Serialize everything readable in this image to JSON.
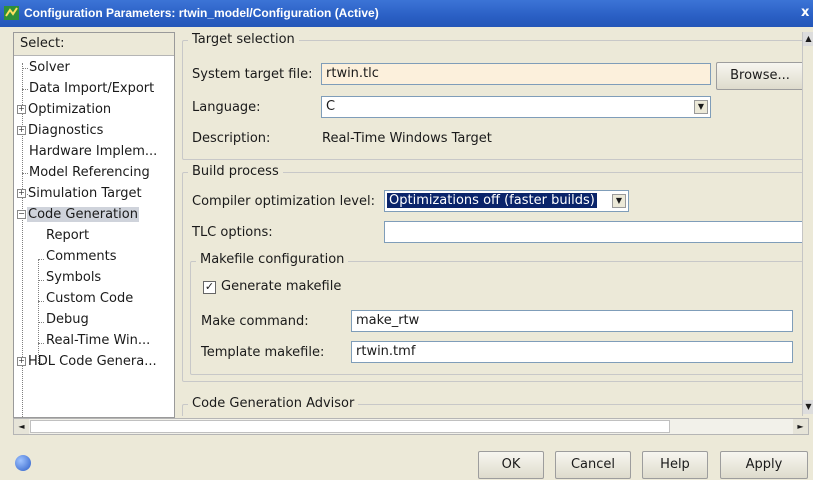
{
  "window": {
    "title": "Configuration Parameters: rtwin_model/Configuration (Active)",
    "close_glyph": "x"
  },
  "tree": {
    "header": "Select:",
    "items": [
      {
        "label": "Solver"
      },
      {
        "label": "Data Import/Export"
      },
      {
        "label": "Optimization",
        "expandable": true
      },
      {
        "label": "Diagnostics",
        "expandable": true
      },
      {
        "label": "Hardware Implem..."
      },
      {
        "label": "Model Referencing"
      },
      {
        "label": "Simulation Target",
        "expandable": true
      },
      {
        "label": "Code Generation",
        "expanded": true,
        "selected": true
      },
      {
        "label": "Report"
      },
      {
        "label": "Comments"
      },
      {
        "label": "Symbols"
      },
      {
        "label": "Custom Code"
      },
      {
        "label": "Debug"
      },
      {
        "label": "Real-Time Win..."
      },
      {
        "label": "HDL Code Genera...",
        "expandable": true
      }
    ]
  },
  "target_selection": {
    "title": "Target selection",
    "system_target_file_label": "System target file:",
    "system_target_file_value": "rtwin.tlc",
    "browse_label": "Browse...",
    "language_label": "Language:",
    "language_value": "C",
    "description_label": "Description:",
    "description_value": "Real-Time Windows Target"
  },
  "build_process": {
    "title": "Build process",
    "compiler_opt_label": "Compiler optimization level:",
    "compiler_opt_value": "Optimizations off (faster builds)",
    "tlc_options_label": "TLC options:",
    "tlc_options_value": "",
    "makefile": {
      "title": "Makefile configuration",
      "generate_label": "Generate makefile",
      "generate_checked": true,
      "make_command_label": "Make command:",
      "make_command_value": "make_rtw",
      "template_label": "Template makefile:",
      "template_value": "rtwin.tmf"
    }
  },
  "advisor": {
    "title": "Code Generation Advisor"
  },
  "buttons": {
    "ok": "OK",
    "cancel": "Cancel",
    "help": "Help",
    "apply": "Apply"
  },
  "glyphs": {
    "check": "✓",
    "dropdown": "▼",
    "up": "▲",
    "down": "▼",
    "left": "◄",
    "right": "►",
    "plus": "+",
    "minus": "−"
  },
  "colors": {
    "title_bar": "#2a5fc4",
    "selection": "#0a246a",
    "highlight_field": "#fcf0dc"
  }
}
